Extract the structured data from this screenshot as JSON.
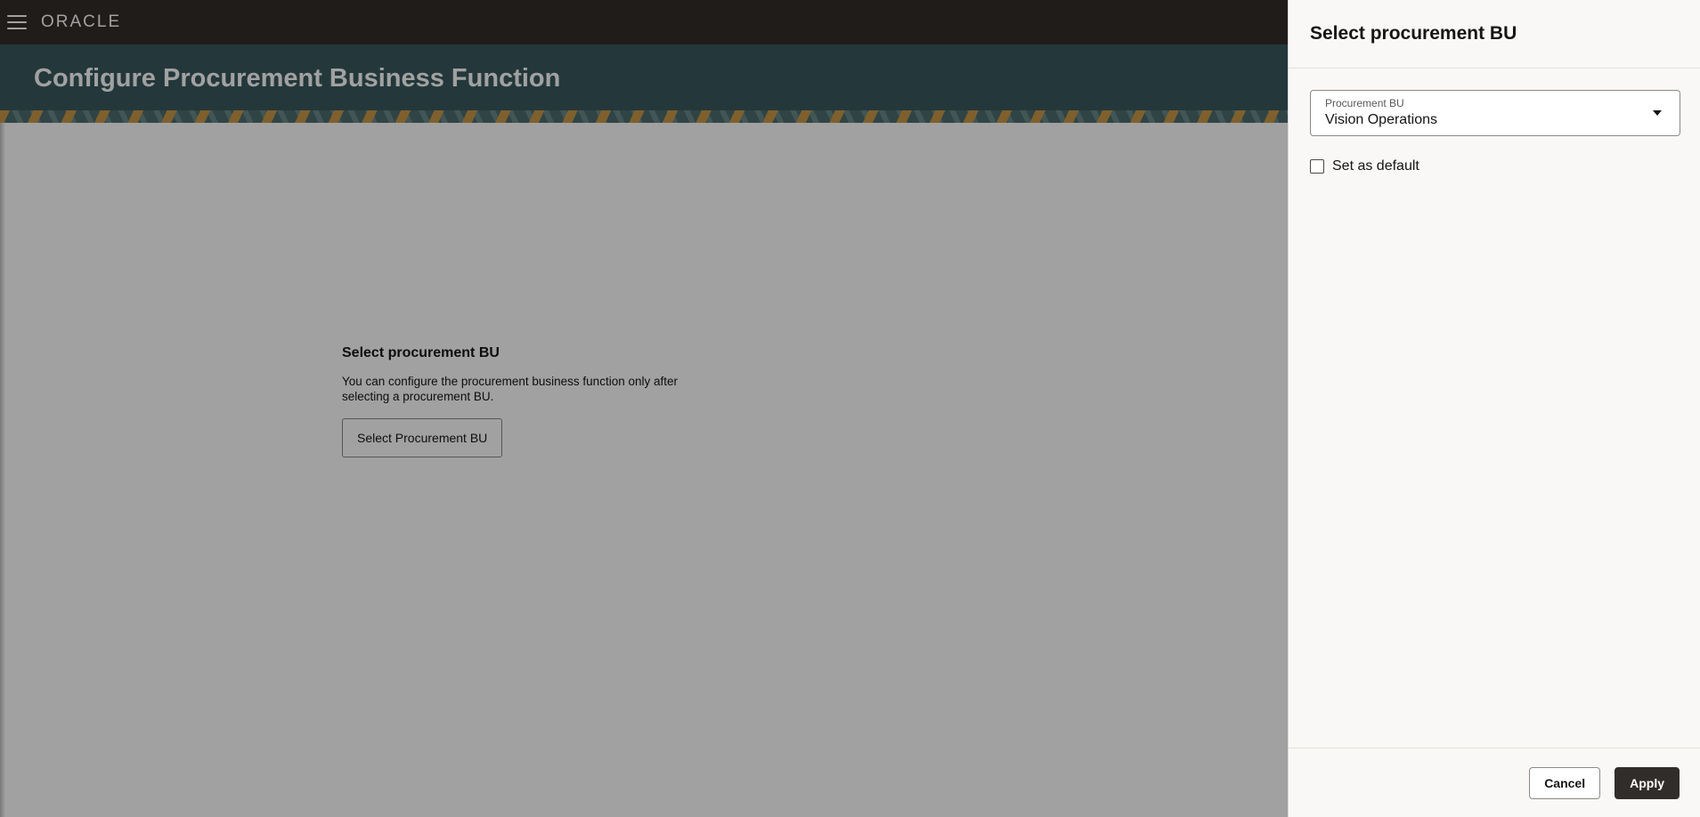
{
  "topbar": {
    "logo": "ORACLE",
    "menu_icon": "hamburger-menu-icon"
  },
  "page": {
    "title": "Configure Procurement Business Function"
  },
  "empty_state": {
    "title": "Select procurement BU",
    "description": "You can configure the procurement business function only after selecting a procurement BU.",
    "button_label": "Select Procurement BU"
  },
  "drawer": {
    "title": "Select procurement BU",
    "field": {
      "label": "Procurement BU",
      "value": "Vision Operations",
      "icon": "caret-down-icon"
    },
    "checkbox": {
      "label": "Set as default",
      "checked": false
    },
    "footer": {
      "cancel_label": "Cancel",
      "apply_label": "Apply"
    }
  },
  "colors": {
    "topbar": "#312d2a",
    "banner": "#3a5a5e",
    "apply_button": "#312d2a"
  }
}
